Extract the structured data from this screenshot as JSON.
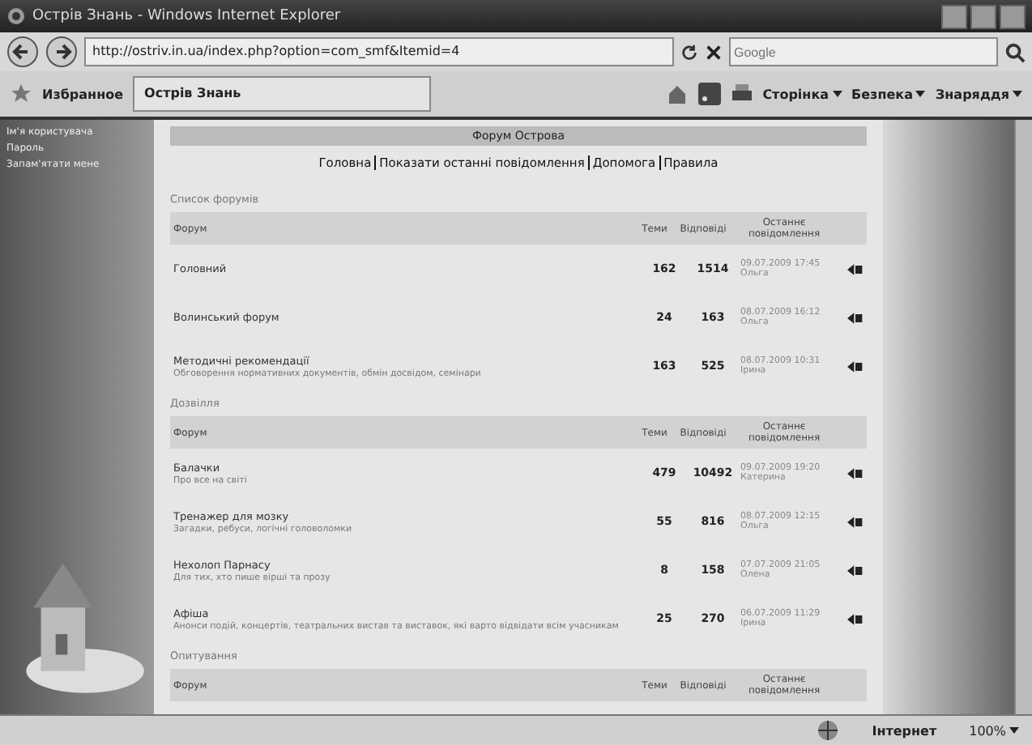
{
  "window": {
    "title": "Острів Знань - Windows Internet Explorer"
  },
  "address": {
    "url": "http://ostriv.in.ua/index.php?option=com_smf&Itemid=4"
  },
  "search": {
    "placeholder": "Google"
  },
  "favorites": {
    "label": "Избранное"
  },
  "tab": {
    "label": "Острів Знань",
    "selected": true
  },
  "toolbar": [
    "Сторінка",
    "Безпека",
    "Знаряддя"
  ],
  "sidebar": {
    "items": [
      "Ім'я користувача",
      "Пароль",
      "Запам'ятати мене"
    ]
  },
  "forum": {
    "title": "Форум Острова",
    "nav": [
      "Головна",
      "Показати останні повідомлення",
      "Допомога",
      "Правила"
    ],
    "sections": [
      {
        "name": "Список форумів",
        "columns": [
          "Форум",
          "Теми",
          "Відповіді",
          "Останнє повідомлення"
        ],
        "rows": [
          {
            "name": "Головний",
            "topics": "162",
            "replies": "1514",
            "last": "09.07.2009 17:45 Ольга"
          },
          {
            "name": "Волинський форум",
            "topics": "24",
            "replies": "163",
            "last": "08.07.2009 16:12 Ольга"
          },
          {
            "name": "Методичні рекомендації",
            "desc": "Обговорення нормативних документів, обмін досвідом, семінари",
            "topics": "163",
            "replies": "525",
            "last": "08.07.2009 10:31 Ірина"
          }
        ]
      },
      {
        "name": "Дозвілля",
        "columns": [
          "Форум",
          "Теми",
          "Відповіді",
          "Останнє повідомлення"
        ],
        "rows": [
          {
            "name": "Балачки",
            "desc": "Про все на світі",
            "topics": "479",
            "replies": "10492",
            "last": "09.07.2009 19:20 Катерина"
          },
          {
            "name": "Тренажер для мозку",
            "desc": "Загадки, ребуси, логічні головоломки",
            "topics": "55",
            "replies": "816",
            "last": "08.07.2009 12:15 Ольга"
          },
          {
            "name": "Нехолоп Парнасу",
            "desc": "Для тих, хто пише вірші та прозу",
            "topics": "8",
            "replies": "158",
            "last": "07.07.2009 21:05 Олена"
          },
          {
            "name": "Афіша",
            "desc": "Анонси подій, концертів, театральних вистав та виставок, які варто відвідати всім учасникам",
            "topics": "25",
            "replies": "270",
            "last": "06.07.2009 11:29 Ірина"
          }
        ]
      },
      {
        "name": "Опитування",
        "columns": [
          "Форум",
          "Теми",
          "Відповіді",
          "Останнє повідомлення"
        ]
      }
    ]
  },
  "status_bar": {
    "zone": "Інтернет",
    "zoom": "100%"
  }
}
